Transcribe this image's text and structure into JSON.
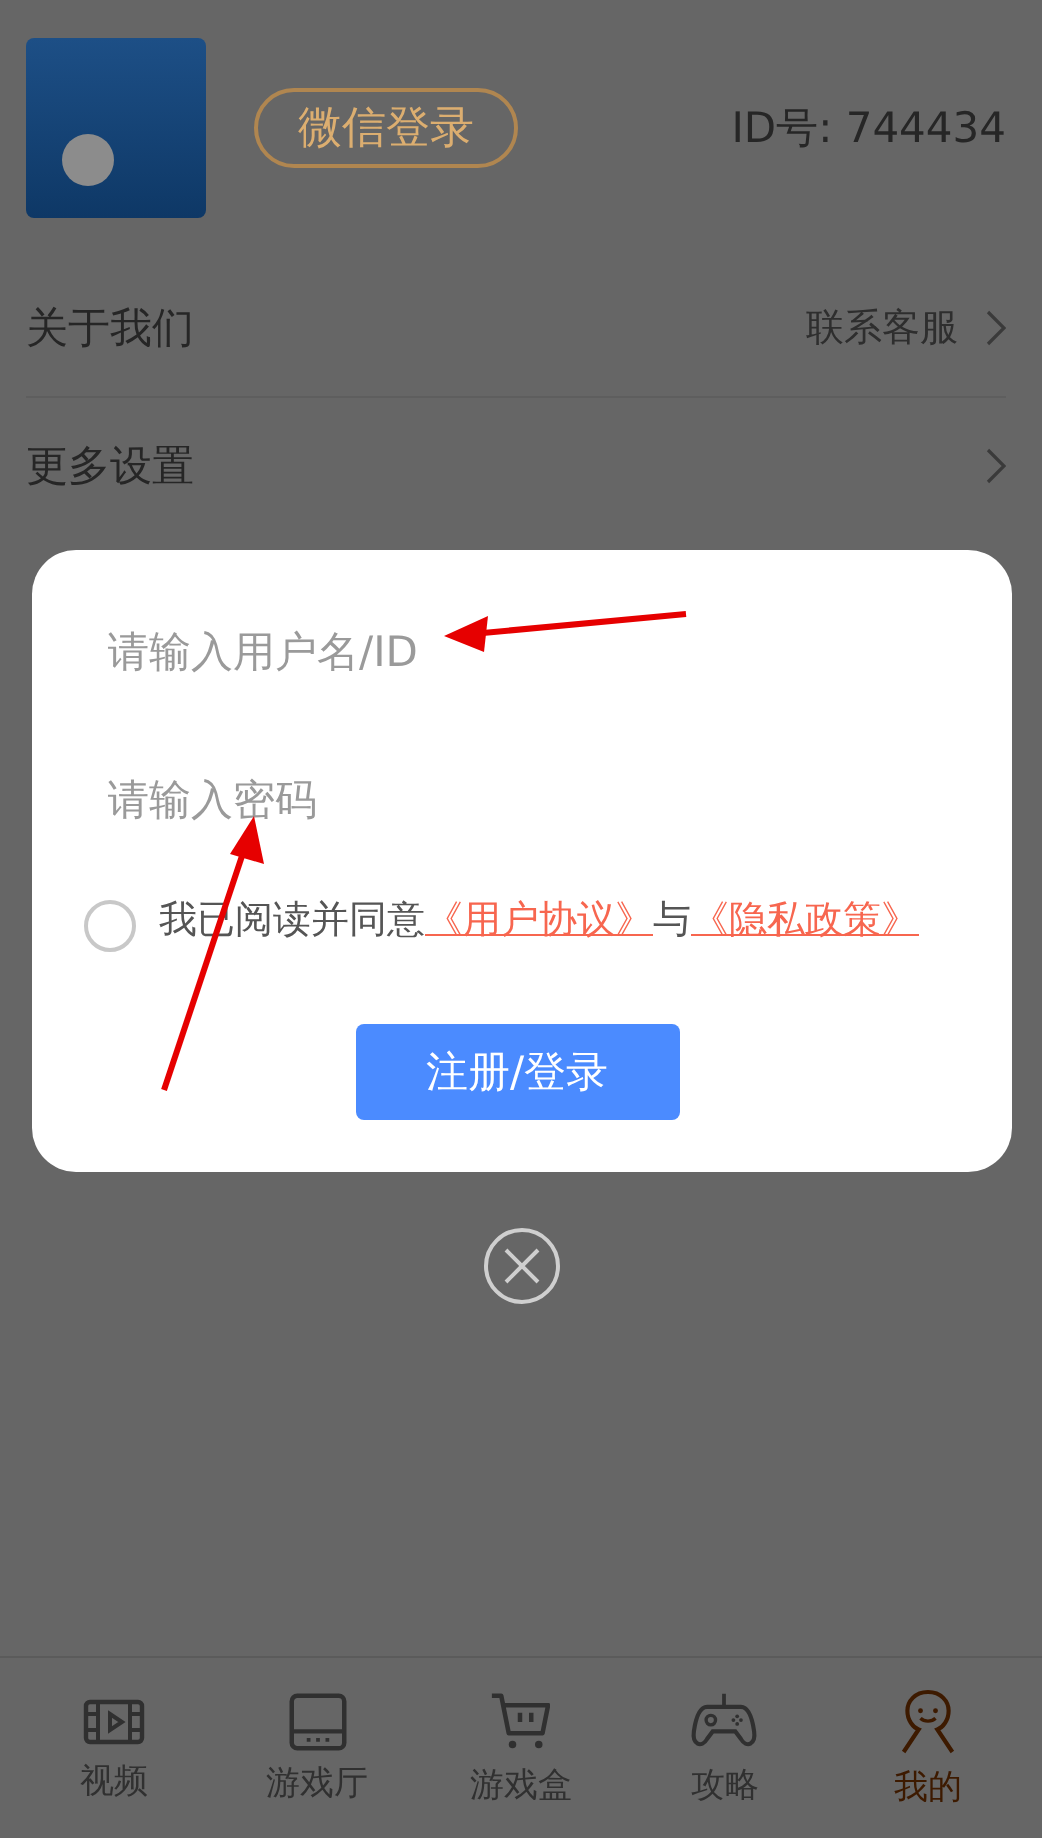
{
  "profile": {
    "login_button": "微信登录",
    "id_text": "ID号: 744434"
  },
  "menu": [
    {
      "label": "关于我们",
      "value": "联系客服"
    },
    {
      "label": "更多设置"
    }
  ],
  "dialog": {
    "username_placeholder": "请输入用户名/ID",
    "password_placeholder": "请输入密码",
    "agreement": {
      "checked": false,
      "text": "我已阅读并同意",
      "user_link": "《用户协议》",
      "joiner": "与",
      "privacy_link": "《隐私政策》"
    },
    "submit_button": "注册/登录"
  },
  "tabs": [
    {
      "label": "视频",
      "kind": "film",
      "selected": false
    },
    {
      "label": "游戏厅",
      "kind": "screen",
      "selected": false
    },
    {
      "label": "游戏盒",
      "kind": "cart",
      "selected": false
    },
    {
      "label": "攻略",
      "kind": "gamepad",
      "selected": false
    },
    {
      "label": "我的",
      "kind": "person",
      "selected": true
    }
  ]
}
